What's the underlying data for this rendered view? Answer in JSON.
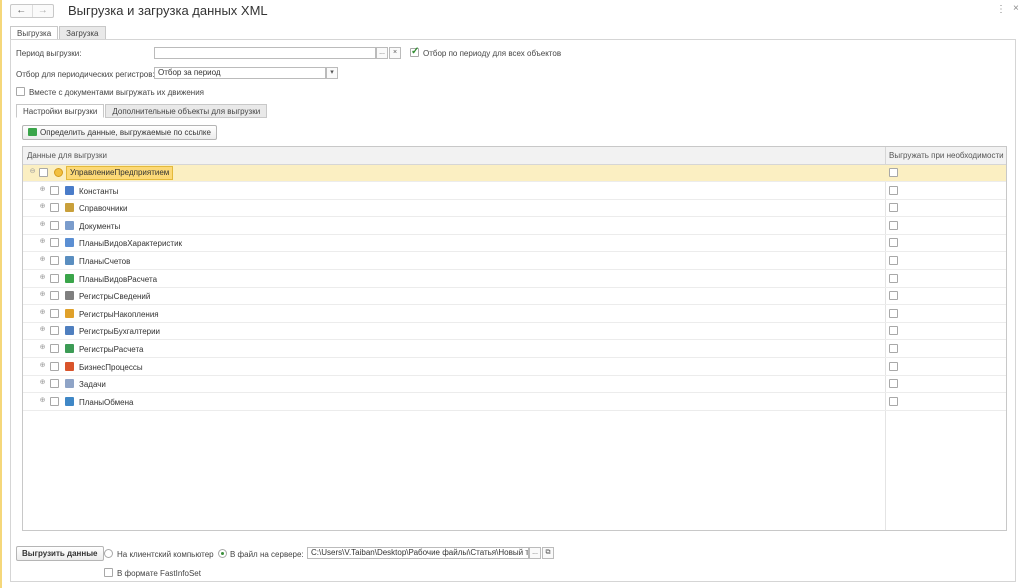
{
  "window": {
    "title": "Выгрузка и загрузка данных XML",
    "nav_back": "←",
    "nav_forward": "→",
    "more": "⋮",
    "close": "×"
  },
  "tabs": [
    "Выгрузка",
    "Загрузка"
  ],
  "form": {
    "period_label": "Период выгрузки:",
    "period_value": "",
    "period_select": "...",
    "period_clear": "×",
    "filter_all_label": "Отбор по периоду для всех объектов",
    "filter_all_checked": true,
    "periodic_label": "Отбор для периодических регистров:",
    "periodic_value": "Отбор за период",
    "periodic_dropdown": "▾",
    "with_movements_label": "Вместе с документами выгружать их движения",
    "with_movements_checked": false
  },
  "inner_tabs": [
    "Настройки выгрузки",
    "Дополнительные объекты для выгрузки"
  ],
  "define_button": "Определить данные, выгружаемые по ссылке",
  "table": {
    "col_data": "Данные для выгрузки",
    "col_export": "Выгружать при необходимости",
    "root": "УправлениеПредприятием",
    "rows": [
      {
        "label": "Константы",
        "icon": "constants-icon",
        "color": "#4a7cc9"
      },
      {
        "label": "Справочники",
        "icon": "catalogs-icon",
        "color": "#c9a03b"
      },
      {
        "label": "Документы",
        "icon": "documents-icon",
        "color": "#7a9ccc"
      },
      {
        "label": "ПланыВидовХарактеристик",
        "icon": "characteristic-types-icon",
        "color": "#5b8fd3"
      },
      {
        "label": "ПланыСчетов",
        "icon": "chart-of-accounts-icon",
        "color": "#5a8ec0"
      },
      {
        "label": "ПланыВидовРасчета",
        "icon": "calculation-types-icon",
        "color": "#3aa54a"
      },
      {
        "label": "РегистрыСведений",
        "icon": "information-registers-icon",
        "color": "#7f7f7f"
      },
      {
        "label": "РегистрыНакопления",
        "icon": "accumulation-registers-icon",
        "color": "#e0a12a"
      },
      {
        "label": "РегистрыБухгалтерии",
        "icon": "accounting-registers-icon",
        "color": "#4f7fbf"
      },
      {
        "label": "РегистрыРасчета",
        "icon": "calculation-registers-icon",
        "color": "#3c9b55"
      },
      {
        "label": "БизнесПроцессы",
        "icon": "business-processes-icon",
        "color": "#d9542b"
      },
      {
        "label": "Задачи",
        "icon": "tasks-icon",
        "color": "#8fa4c7"
      },
      {
        "label": "ПланыОбмена",
        "icon": "exchange-plans-icon",
        "color": "#3f87c6"
      }
    ]
  },
  "bottom": {
    "export_button": "Выгрузить данные",
    "client_label": "На клиентский компьютер",
    "client_selected": false,
    "server_label": "В файл на сервере:",
    "server_selected": true,
    "path_value": "C:\\Users\\V.Taiban\\Desktop\\Рабочие файлы\\Статья\\Новый тег",
    "path_select": "...",
    "path_open": "⧉",
    "fastinfoset_label": "В формате FastInfoSet",
    "fastinfoset_checked": false
  }
}
